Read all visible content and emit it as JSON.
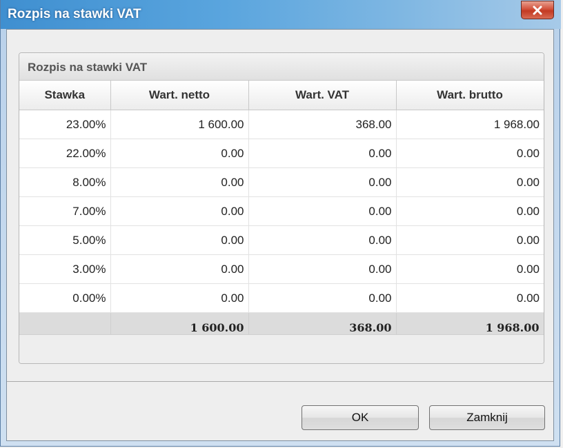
{
  "window": {
    "title": "Rozpis na stawki VAT"
  },
  "panel": {
    "title": "Rozpis na stawki VAT"
  },
  "table": {
    "columns": [
      "Stawka",
      "Wart. netto",
      "Wart. VAT",
      "Wart. brutto"
    ],
    "rows": [
      [
        "23.00%",
        "1 600.00",
        "368.00",
        "1 968.00"
      ],
      [
        "22.00%",
        "0.00",
        "0.00",
        "0.00"
      ],
      [
        "8.00%",
        "0.00",
        "0.00",
        "0.00"
      ],
      [
        "7.00%",
        "0.00",
        "0.00",
        "0.00"
      ],
      [
        "5.00%",
        "0.00",
        "0.00",
        "0.00"
      ],
      [
        "3.00%",
        "0.00",
        "0.00",
        "0.00"
      ],
      [
        "0.00%",
        "0.00",
        "0.00",
        "0.00"
      ]
    ],
    "totals": [
      "",
      "1 600.00",
      "368.00",
      "1 968.00"
    ]
  },
  "buttons": {
    "ok": "OK",
    "close": "Zamknij"
  },
  "icons": {
    "close": "close-icon"
  },
  "colors": {
    "titlebar": "#3f8fd0",
    "close_button": "#c23a23"
  }
}
